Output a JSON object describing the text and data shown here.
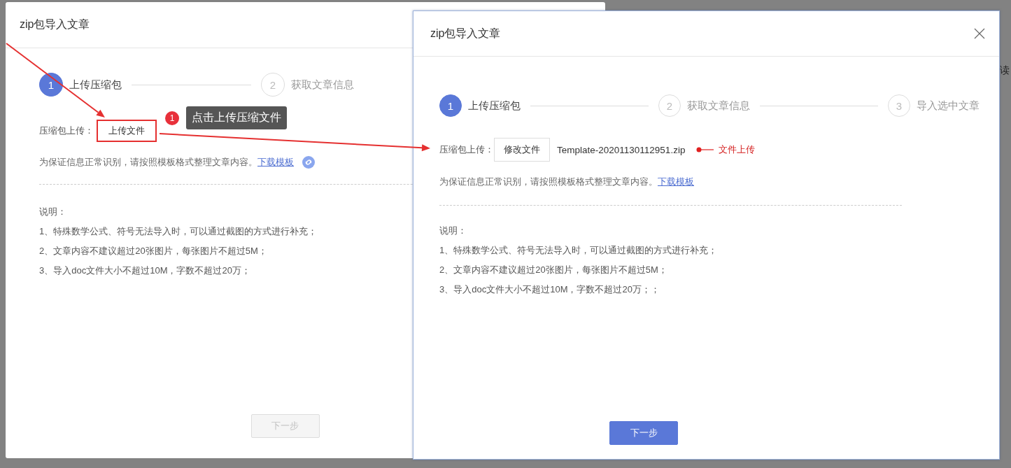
{
  "backdrop": {
    "text": "读"
  },
  "dialogs": [
    {
      "title": "zip包导入文章",
      "steps": [
        {
          "number": "1",
          "label": "上传压缩包",
          "active": true
        },
        {
          "number": "2",
          "label": "获取文章信息",
          "active": false
        }
      ],
      "upload": {
        "label": "压缩包上传：",
        "button": "上传文件",
        "highlighted": true,
        "callout": {
          "number": "1",
          "text": "点击上传压缩文件"
        }
      },
      "hint": {
        "text": "为保证信息正常识别，请按照模板格式整理文章内容。",
        "link": "下载模板",
        "link_icon": true
      },
      "notes": {
        "heading": "说明：",
        "items": [
          "1、特殊数学公式、符号无法导入时，可以通过截图的方式进行补充；",
          "2、文章内容不建议超过20张图片，每张图片不超过5M；",
          "3、导入doc文件大小不超过10M，字数不超过20万；"
        ]
      },
      "next_button": {
        "label": "下一步",
        "disabled": true
      }
    },
    {
      "title": "zip包导入文章",
      "closable": true,
      "steps": [
        {
          "number": "1",
          "label": "上传压缩包",
          "active": true
        },
        {
          "number": "2",
          "label": "获取文章信息",
          "active": false
        },
        {
          "number": "3",
          "label": "导入选中文章",
          "active": false
        }
      ],
      "upload": {
        "label": "压缩包上传：",
        "button": "修改文件",
        "filename": "Template-20201130112951.zip",
        "note": "文件上传"
      },
      "hint": {
        "text": "为保证信息正常识别，请按照模板格式整理文章内容。",
        "link": "下载模板"
      },
      "notes": {
        "heading": "说明：",
        "items": [
          "1、特殊数学公式、符号无法导入时，可以通过截图的方式进行补充；",
          "2、文章内容不建议超过20张图片，每张图片不超过5M；",
          "3、导入doc文件大小不超过10M，字数不超过20万；；"
        ]
      },
      "next_button": {
        "label": "下一步",
        "disabled": false
      }
    }
  ]
}
